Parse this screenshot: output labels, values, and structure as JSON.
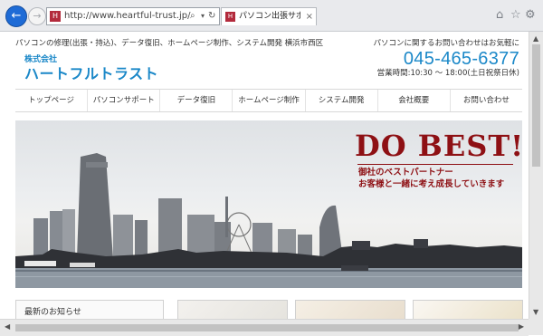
{
  "browser": {
    "url": "http://www.heartful-trust.jp/",
    "tab_title": "パソコン出張サポート(出張-...",
    "favicon_text": "H",
    "back_icon": "arrow-left",
    "forward_icon": "arrow-right",
    "search_icon": "⌕",
    "refresh_icon": "↻",
    "tab_close": "×",
    "toolbar_icons": [
      "home-icon",
      "star-icon",
      "gear-icon"
    ]
  },
  "header": {
    "tagline": "パソコンの修理(出張・持込)、データ復旧、ホームページ制作、システム開発 横浜市西区",
    "company_prefix": "株式会社",
    "company_name": "ハートフルトラスト",
    "contact_prompt": "パソコンに関するお問い合わせはお気軽に",
    "phone": "045-465-6377",
    "hours": "営業時間:10:30 ～ 18:00(土日祝祭日休)"
  },
  "nav": {
    "items": [
      {
        "label": "トップページ"
      },
      {
        "label": "パソコンサポート"
      },
      {
        "label": "データ復旧"
      },
      {
        "label": "ホームページ制作"
      },
      {
        "label": "システム開発"
      },
      {
        "label": "会社概要"
      },
      {
        "label": "お問い合わせ"
      }
    ]
  },
  "hero": {
    "headline": "DO BEST!",
    "line1": "御社のベストパートナー",
    "line2": "お客様と一緒に考え成長していきます",
    "accent_color": "#8e1014"
  },
  "sidebar": {
    "news_title": "最新のお知らせ"
  },
  "colors": {
    "brand": "#1b88c8",
    "back_button": "#1e6bd6"
  }
}
